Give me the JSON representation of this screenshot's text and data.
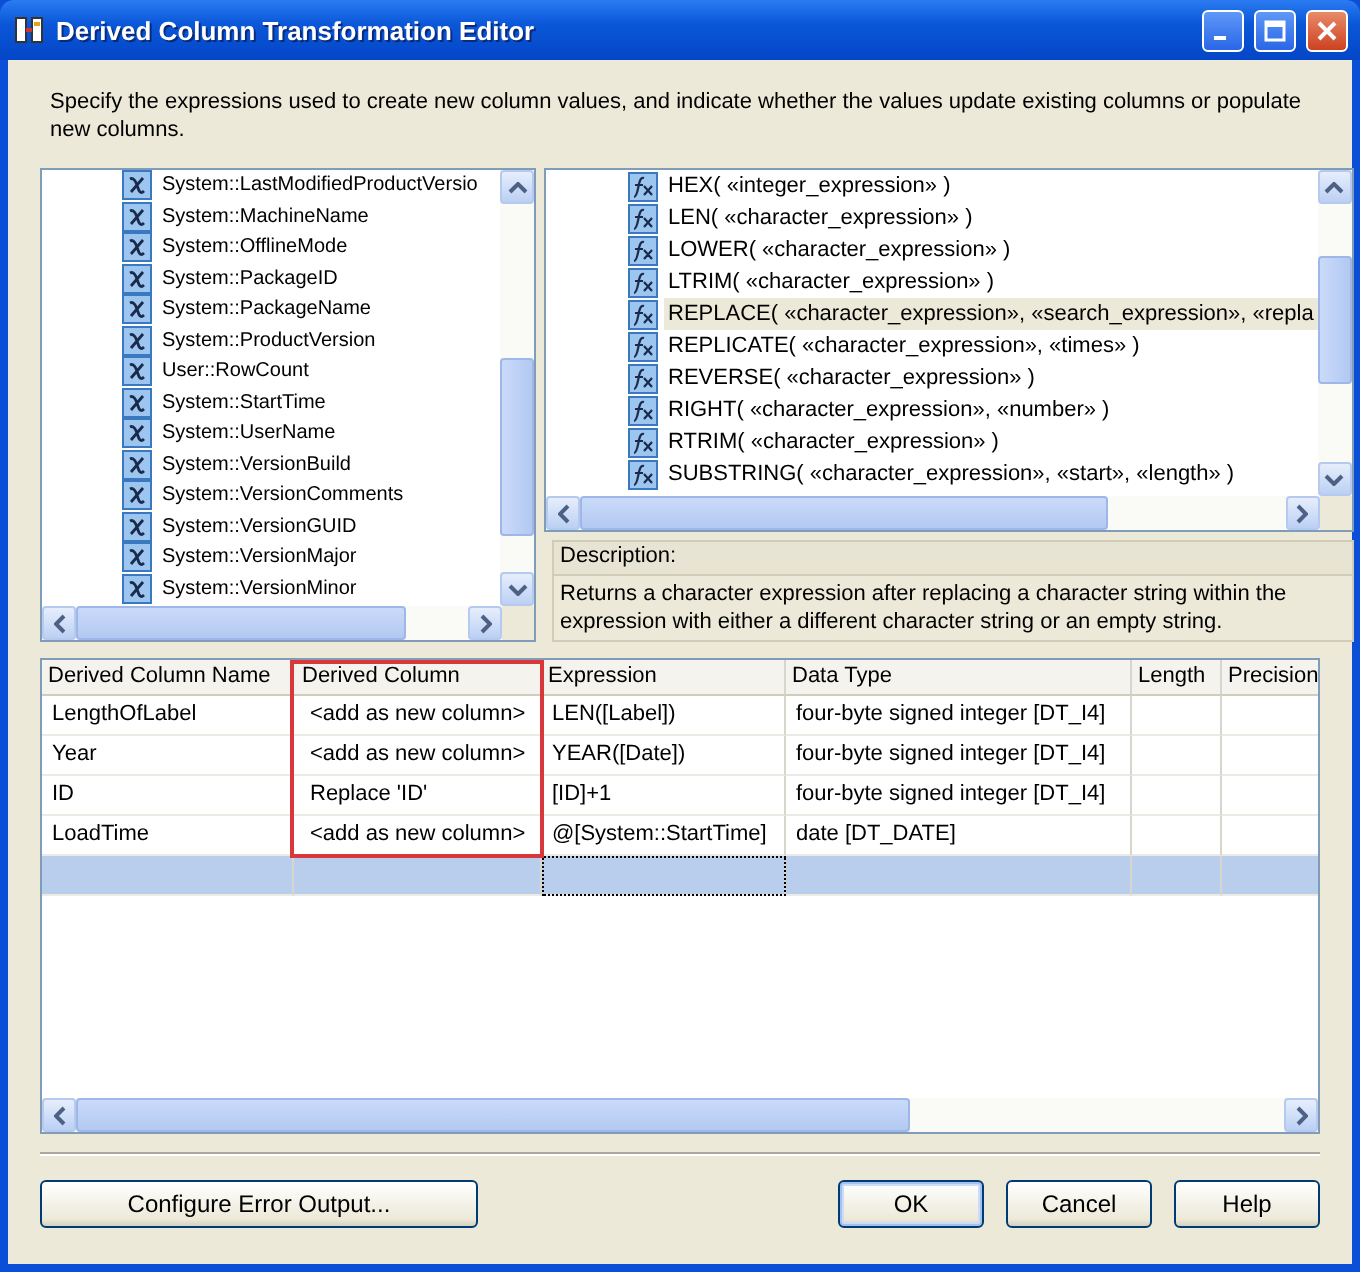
{
  "window": {
    "title": "Derived Column Transformation Editor"
  },
  "instructions": "Specify the expressions used to create new column values, and indicate whether the values update existing columns or populate new columns.",
  "variables": [
    {
      "label": "System::LastModifiedProductVersio"
    },
    {
      "label": "System::MachineName"
    },
    {
      "label": "System::OfflineMode"
    },
    {
      "label": "System::PackageID"
    },
    {
      "label": "System::PackageName"
    },
    {
      "label": "System::ProductVersion"
    },
    {
      "label": "User::RowCount"
    },
    {
      "label": "System::StartTime"
    },
    {
      "label": "System::UserName"
    },
    {
      "label": "System::VersionBuild"
    },
    {
      "label": "System::VersionComments"
    },
    {
      "label": "System::VersionGUID"
    },
    {
      "label": "System::VersionMajor"
    },
    {
      "label": "System::VersionMinor"
    }
  ],
  "functions": [
    {
      "label": "HEX( «integer_expression» )",
      "selected": false
    },
    {
      "label": "LEN( «character_expression» )",
      "selected": false
    },
    {
      "label": "LOWER( «character_expression» )",
      "selected": false
    },
    {
      "label": "LTRIM( «character_expression» )",
      "selected": false
    },
    {
      "label": "REPLACE( «character_expression», «search_expression», «repla",
      "selected": true
    },
    {
      "label": "REPLICATE( «character_expression», «times» )",
      "selected": false
    },
    {
      "label": "REVERSE( «character_expression» )",
      "selected": false
    },
    {
      "label": "RIGHT( «character_expression», «number» )",
      "selected": false
    },
    {
      "label": "RTRIM( «character_expression» )",
      "selected": false
    },
    {
      "label": "SUBSTRING( «character_expression», «start», «length» )",
      "selected": false
    }
  ],
  "description": {
    "label": "Description:",
    "text": "Returns a character expression after replacing a character string within the expression with either a different character string or an empty string."
  },
  "grid": {
    "columns": [
      {
        "label": "Derived Column Name",
        "outlined": false
      },
      {
        "label": "Derived Column",
        "outlined": true
      },
      {
        "label": "Expression",
        "outlined": false
      },
      {
        "label": "Data Type",
        "outlined": false
      },
      {
        "label": "Length",
        "outlined": false
      },
      {
        "label": "Precision",
        "outlined": false
      }
    ],
    "rows": [
      {
        "cells": [
          "LengthOfLabel",
          "<add as new column>",
          "LEN([Label])",
          "four-byte signed integer [DT_I4]",
          "",
          ""
        ],
        "selected": false
      },
      {
        "cells": [
          "Year",
          "<add as new column>",
          "YEAR([Date])",
          "four-byte signed integer [DT_I4]",
          "",
          ""
        ],
        "selected": false
      },
      {
        "cells": [
          "ID",
          "Replace 'ID'",
          "[ID]+1",
          "four-byte signed integer [DT_I4]",
          "",
          ""
        ],
        "selected": false
      },
      {
        "cells": [
          "LoadTime",
          "<add as new column>",
          "@[System::StartTime]",
          "date [DT_DATE]",
          "",
          ""
        ],
        "selected": false
      },
      {
        "cells": [
          "",
          "",
          "",
          "",
          "",
          ""
        ],
        "selected": true
      }
    ]
  },
  "buttons": [
    {
      "label": "Configure Error Output...",
      "kind": "left",
      "default": false
    },
    {
      "label": "OK",
      "kind": "right",
      "default": true
    },
    {
      "label": "Cancel",
      "kind": "right",
      "default": false
    },
    {
      "label": "Help",
      "kind": "right",
      "default": false
    }
  ]
}
